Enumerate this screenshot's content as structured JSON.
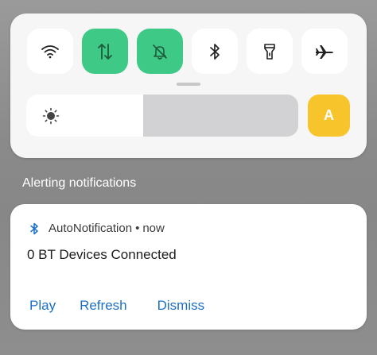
{
  "quick_settings": {
    "tiles": [
      {
        "name": "wifi",
        "icon": "wifi-icon",
        "active": false
      },
      {
        "name": "mobile-data",
        "icon": "data-arrows-icon",
        "active": true
      },
      {
        "name": "do-not-disturb",
        "icon": "bell-off-icon",
        "active": true
      },
      {
        "name": "bluetooth",
        "icon": "bluetooth-icon",
        "active": false
      },
      {
        "name": "flashlight",
        "icon": "flashlight-icon",
        "active": false
      },
      {
        "name": "airplane-mode",
        "icon": "airplane-icon",
        "active": false
      }
    ],
    "brightness_level": 0.43,
    "auto_brightness_label": "A"
  },
  "colors": {
    "active_tile": "#3ec986",
    "auto_button": "#f7c52b",
    "action_link": "#1c6fc8"
  },
  "section": {
    "title": "Alerting notifications"
  },
  "notification": {
    "app_name": "AutoNotification",
    "separator": "•",
    "time": "now",
    "title": "0 BT Devices Connected",
    "actions": [
      "Play",
      "Refresh",
      "Dismiss"
    ]
  }
}
